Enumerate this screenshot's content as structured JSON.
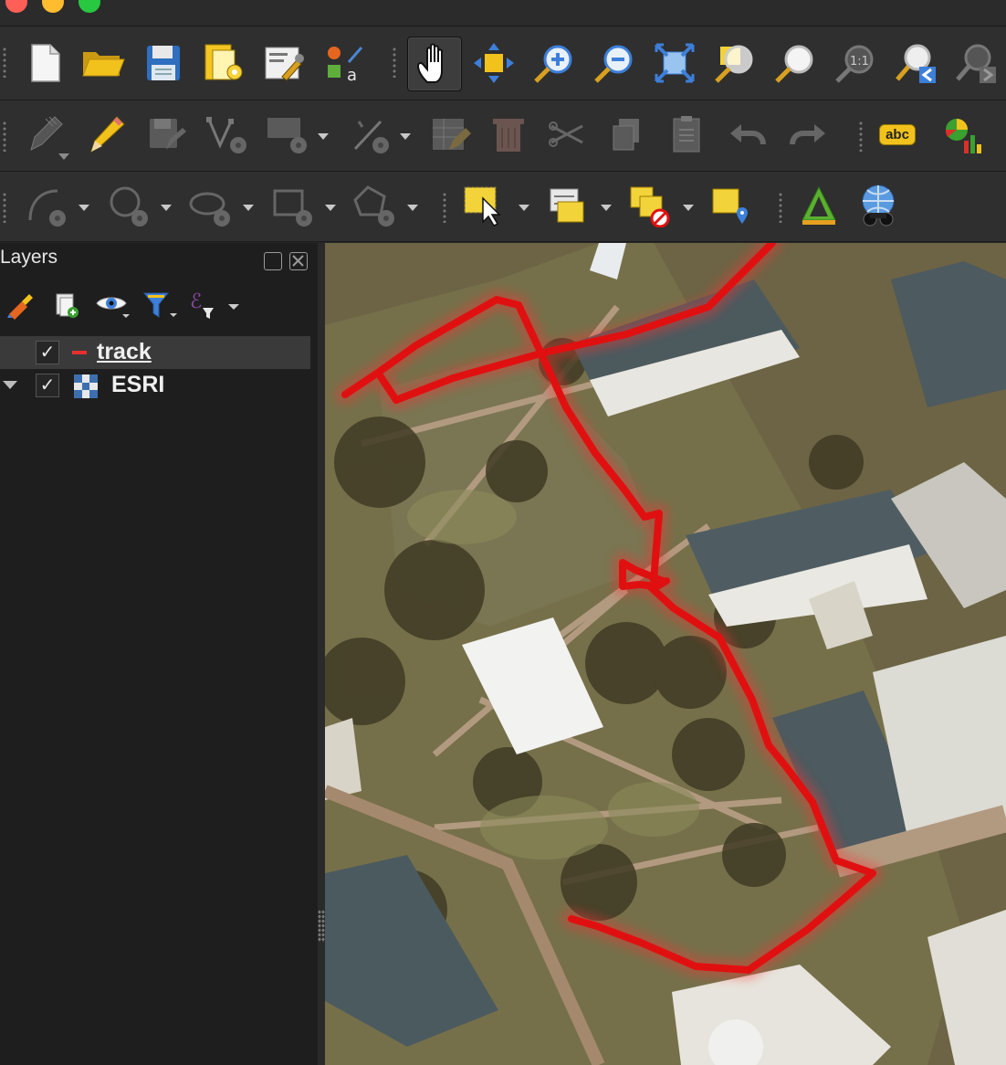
{
  "window": {
    "traffic_lights": [
      {
        "name": "close",
        "color": "#ff5f57"
      },
      {
        "name": "minimize",
        "color": "#febc2e"
      },
      {
        "name": "zoom",
        "color": "#28c840"
      }
    ]
  },
  "toolbars": {
    "project": [
      "new-project-icon",
      "open-project-icon",
      "save-project-icon",
      "layout-manager-icon",
      "style-manager-icon",
      "labeling-icon"
    ],
    "navigation": [
      "pan-icon",
      "pan-to-selection-icon",
      "zoom-in-icon",
      "zoom-out-icon",
      "zoom-full-icon",
      "zoom-to-selection-icon",
      "zoom-to-layer-icon",
      "zoom-native-icon",
      "zoom-last-icon",
      "zoom-next-icon"
    ],
    "digitizing": [
      "current-edits-icon",
      "toggle-editing-icon",
      "save-edits-icon",
      "vertex-tool-icon",
      "add-feature-icon",
      "move-feature-icon",
      "attribute-table-icon",
      "delete-icon",
      "cut-icon",
      "copy-icon",
      "paste-icon",
      "undo-icon",
      "redo-icon"
    ],
    "labels_button": "abc",
    "shape": [
      "circular-string-icon",
      "circle-icon",
      "ellipse-icon",
      "rectangle-icon",
      "polygon-icon"
    ],
    "selection": [
      "select-features-icon",
      "select-by-attribute-icon",
      "deselect-icon",
      "select-by-location-icon",
      "georeferencer-icon",
      "geocoder-icon"
    ]
  },
  "layers_panel": {
    "title": "Layers",
    "layers": [
      {
        "name": "track",
        "checked": true,
        "type": "line",
        "color": "#e63030",
        "selected": true
      },
      {
        "name": "ESRI",
        "checked": true,
        "type": "raster",
        "expanded": true
      }
    ]
  },
  "map": {
    "track_color": "#e01010",
    "basemap": "ESRI satellite imagery"
  }
}
